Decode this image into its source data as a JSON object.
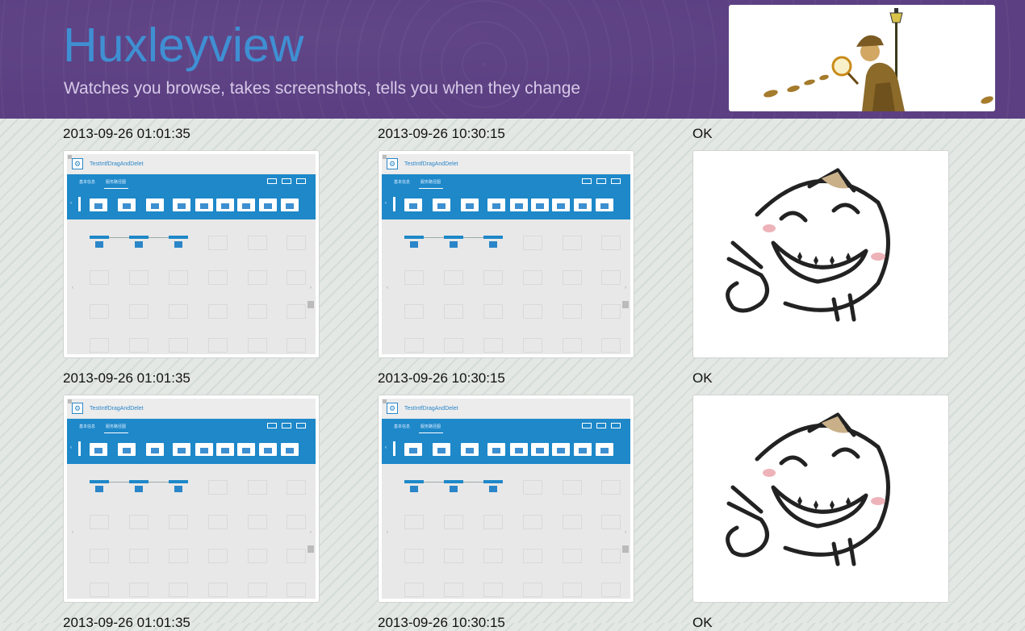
{
  "app": {
    "title": "Huxleyview",
    "subtitle": "Watches you browse, takes screenshots, tells you when they change"
  },
  "rows": [
    {
      "left_time": "2013-09-26 01:01:35",
      "mid_time": "2013-09-26 10:30:15",
      "status": "OK"
    },
    {
      "left_time": "2013-09-26 01:01:35",
      "mid_time": "2013-09-26 10:30:15",
      "status": "OK"
    },
    {
      "left_time": "2013-09-26 01:01:35",
      "mid_time": "2013-09-26 10:30:15",
      "status": "OK"
    }
  ],
  "screenshot": {
    "window_title": "TestIntfDragAndDelet",
    "tab_basic": "基本信息",
    "tab_service": "服务路径图",
    "toolbar_m": "M"
  },
  "colors": {
    "header_bg": "#5b3f82",
    "title": "#3f8fd3",
    "accent_blue": "#1e88c9"
  },
  "icons": {
    "logo": "detective-with-magnifier-icon",
    "status_image": "grinning-peace-sign-face-icon"
  }
}
